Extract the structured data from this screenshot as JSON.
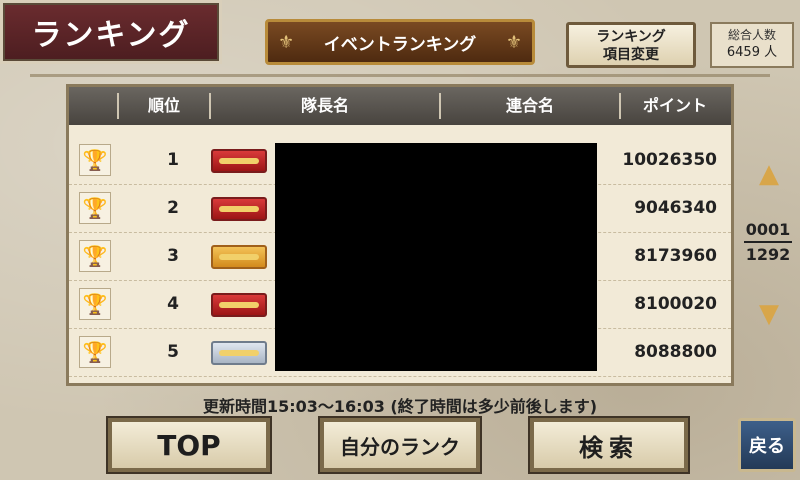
{
  "title": "ランキング",
  "banner": "イベントランキング",
  "change_button": {
    "line1": "ランキング",
    "line2": "項目変更"
  },
  "total": {
    "label": "総合人数",
    "value": "6459 人"
  },
  "table": {
    "headers": [
      "順位",
      "隊長名",
      "連合名",
      "ポイント"
    ],
    "rows": [
      {
        "rank": "1",
        "badge": "red",
        "points": "10026350"
      },
      {
        "rank": "2",
        "badge": "red",
        "points": "9046340"
      },
      {
        "rank": "3",
        "badge": "gold",
        "points": "8173960"
      },
      {
        "rank": "4",
        "badge": "red",
        "points": "8100020"
      },
      {
        "rank": "5",
        "badge": "silver",
        "points": "8088800"
      }
    ]
  },
  "page": {
    "current": "0001",
    "total": "1292"
  },
  "update_note": "更新時間15:03～16:03 (終了時間は多少前後します)",
  "buttons": {
    "top": "TOP",
    "my_rank": "自分のランク",
    "search": "検索",
    "back": "戻る"
  },
  "colors": {
    "badge_red": "#c12a2a",
    "badge_gold": "#e2a33a",
    "badge_silver": "#c3ccd8",
    "header": "#55514b"
  }
}
